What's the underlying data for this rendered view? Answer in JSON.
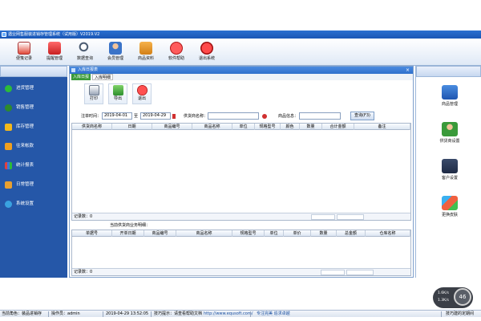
{
  "window": {
    "title": "遇业网售服装进销存管理系统（试用版）V2019.V2"
  },
  "toolbar": {
    "items": [
      {
        "label": "便笺记录",
        "icon": "notepad-icon"
      },
      {
        "label": "提醒管理",
        "icon": "reminder-icon"
      },
      {
        "label": "数据查询",
        "icon": "magnifier-icon"
      },
      {
        "label": "会员管理",
        "icon": "members-icon"
      },
      {
        "label": "商品资料",
        "icon": "product-box-icon"
      },
      {
        "label": "软件帮助",
        "icon": "help-icon"
      },
      {
        "label": "退出系统",
        "icon": "power-icon"
      }
    ]
  },
  "left_menu": {
    "items": [
      {
        "label": "进货管理",
        "icon": "plus-icon",
        "color": "#2dbb3a"
      },
      {
        "label": "销售管理",
        "icon": "minus-icon",
        "color": "#2d8a2d"
      },
      {
        "label": "库存管理",
        "icon": "star-icon",
        "color": "#f3b81c"
      },
      {
        "label": "往来帐款",
        "icon": "dollar-icon",
        "color": "#f0a020"
      },
      {
        "label": "统计报表",
        "icon": "bar-chart-icon",
        "color": "#e24040"
      },
      {
        "label": "日常管理",
        "icon": "folder-icon",
        "color": "#e8a030"
      },
      {
        "label": "系统设置",
        "icon": "gear-icon",
        "color": "#3aa3e0"
      }
    ]
  },
  "subwindow": {
    "title": "入库日报表",
    "tabs": [
      "入库日报",
      "入库明细"
    ],
    "active_tab": 0,
    "actions": [
      {
        "label": "打印",
        "icon": "printer-icon"
      },
      {
        "label": "导出",
        "icon": "export-icon"
      },
      {
        "label": "退出",
        "icon": "close-circle-icon"
      }
    ],
    "filter": {
      "date_label": "注单时间：",
      "date_from": "2019-04-01",
      "to_label": "至",
      "date_to": "2019-04-29",
      "supplier_label": "供货商名称：",
      "supplier_value": "",
      "product_label": "商品信息：",
      "product_value": "",
      "query_button": "查询(F3)"
    },
    "grid1": {
      "columns": [
        "供货商名称",
        "日期",
        "商品编号",
        "商品名称",
        "单位",
        "规格型号",
        "颜色",
        "数量",
        "合计金额",
        "备注"
      ],
      "footer_label": "记录数：",
      "footer_count": "0"
    },
    "biz_title": "当前供货商业务明细：",
    "grid2": {
      "columns": [
        "单据号",
        "开单日期",
        "商品编号",
        "商品名称",
        "规格型号",
        "单位",
        "单价",
        "数量",
        "总金额",
        "仓库名称"
      ],
      "footer_label": "记录数：",
      "footer_count": "0"
    }
  },
  "right_panel": {
    "items": [
      {
        "label": "商品管理",
        "icon": "product-mgmt-icon"
      },
      {
        "label": "供货商设置",
        "icon": "supplier-icon"
      },
      {
        "label": "客户设置",
        "icon": "customer-icon"
      },
      {
        "label": "更换皮肤",
        "icon": "skin-icon"
      }
    ]
  },
  "statusbar": {
    "store": "当前角色：装品进销存",
    "operator": "操作员：admin",
    "datetime": "2019-04-29 13:52:05",
    "hint": "技巧提示：请查看帮助文档",
    "url": "http://www.equsoft.com/",
    "slogan": "专注完美 追求卓越",
    "company": "技巧建的定期间"
  },
  "network_widget": {
    "up": "1.6K/s",
    "down": "1.3K/s",
    "percent": "46"
  }
}
